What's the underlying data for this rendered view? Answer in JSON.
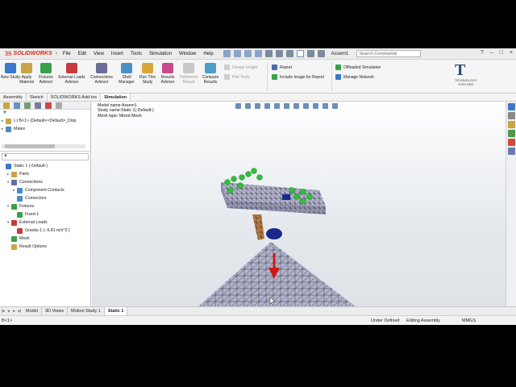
{
  "app": {
    "brand": "SOLIDWORKS",
    "brand_mark": "3S"
  },
  "menu": [
    "File",
    "Edit",
    "View",
    "Insert",
    "Tools",
    "Simulation",
    "Window",
    "Help"
  ],
  "toolbar": {
    "assem_label": "Assem1",
    "search_placeholder": "Search Commands"
  },
  "ribbon": {
    "buttons": [
      {
        "label": "New Study",
        "icon": "new-study-icon",
        "color": "#3a78c9"
      },
      {
        "label": "Apply Material",
        "icon": "apply-material-icon",
        "color": "#c9a545"
      },
      {
        "label": "Fixtures Advisor",
        "icon": "fixtures-icon",
        "color": "#3aa14a"
      },
      {
        "label": "External Loads Advisor",
        "icon": "external-loads-icon",
        "color": "#c83a3a"
      },
      {
        "label": "Connections Advisor",
        "icon": "connections-icon",
        "color": "#6d6d9c"
      },
      {
        "label": "Shell Manager",
        "icon": "shell-manager-icon",
        "color": "#4a90c8"
      },
      {
        "label": "Run This Study",
        "icon": "run-study-icon",
        "color": "#d9a63a"
      },
      {
        "label": "Results Advisor",
        "icon": "results-advisor-icon",
        "color": "#c94a8c"
      },
      {
        "label": "Deformed Result",
        "icon": "deformed-result-icon",
        "color": "#b9b9b9"
      },
      {
        "label": "Compare Results",
        "icon": "compare-results-icon",
        "color": "#4a9ec9"
      }
    ],
    "small": [
      {
        "label": "Design Insight",
        "disabled": true
      },
      {
        "label": "Plot Tools",
        "disabled": true
      },
      {
        "label": "Report",
        "disabled": false
      },
      {
        "label": "Include Image for Report",
        "disabled": false
      },
      {
        "label": "Offloaded Simulation",
        "disabled": false
      },
      {
        "label": "Manage Network",
        "disabled": false
      }
    ],
    "brand_logo": {
      "letter": "T",
      "sub": "TECHNOLOGY EXPLORE"
    }
  },
  "tabs": [
    "Assembly",
    "Sketch",
    "SOLIDWORKS Add-Ins",
    "Simulation"
  ],
  "tree_upper": [
    {
      "label": "(-) B<1> (Default<<Default>_Disp",
      "icon_color": "#c9a545",
      "arrow": "▸"
    },
    {
      "label": "Mates",
      "icon_color": "#4a8ac9",
      "arrow": "▸"
    }
  ],
  "tree_lower": [
    {
      "label": "Static 1 (-Default-)",
      "indent": 0,
      "arrow": "",
      "icon_color": "#3a7ac9"
    },
    {
      "label": "Parts",
      "indent": 1,
      "arrow": "▸",
      "icon_color": "#c9a545"
    },
    {
      "label": "Connections",
      "indent": 1,
      "arrow": "▾",
      "icon_color": "#6d6d9c"
    },
    {
      "label": "Component Contacts",
      "indent": 2,
      "arrow": "▸",
      "icon_color": "#4a8ac9"
    },
    {
      "label": "Connectors",
      "indent": 2,
      "arrow": "",
      "icon_color": "#4a8ac9"
    },
    {
      "label": "Fixtures",
      "indent": 1,
      "arrow": "▾",
      "icon_color": "#3aa14a"
    },
    {
      "label": "Fixed-1",
      "indent": 2,
      "arrow": "",
      "icon_color": "#3aa14a"
    },
    {
      "label": "External Loads",
      "indent": 1,
      "arrow": "▾",
      "icon_color": "#c83a3a"
    },
    {
      "label": "Gravity-1 (:-9.81 m/s^2:)",
      "indent": 2,
      "arrow": "",
      "icon_color": "#c83a3a"
    },
    {
      "label": "Mesh",
      "indent": 1,
      "arrow": "",
      "icon_color": "#3aa14a"
    },
    {
      "label": "Result Options",
      "indent": 1,
      "arrow": "",
      "icon_color": "#c9a545"
    }
  ],
  "viewport": {
    "info": [
      "Model name:Assem1",
      "Study name:Static 1(-Default-)",
      "Mesh type: Mixed Mesh"
    ]
  },
  "bottom_tabs": [
    "Model",
    "3D Views",
    "Motion Study 1",
    "Static 1"
  ],
  "status": {
    "left": "B<1>",
    "constraint": "Under Defined",
    "mode": "Editing Assembly",
    "units": "MMGS"
  }
}
